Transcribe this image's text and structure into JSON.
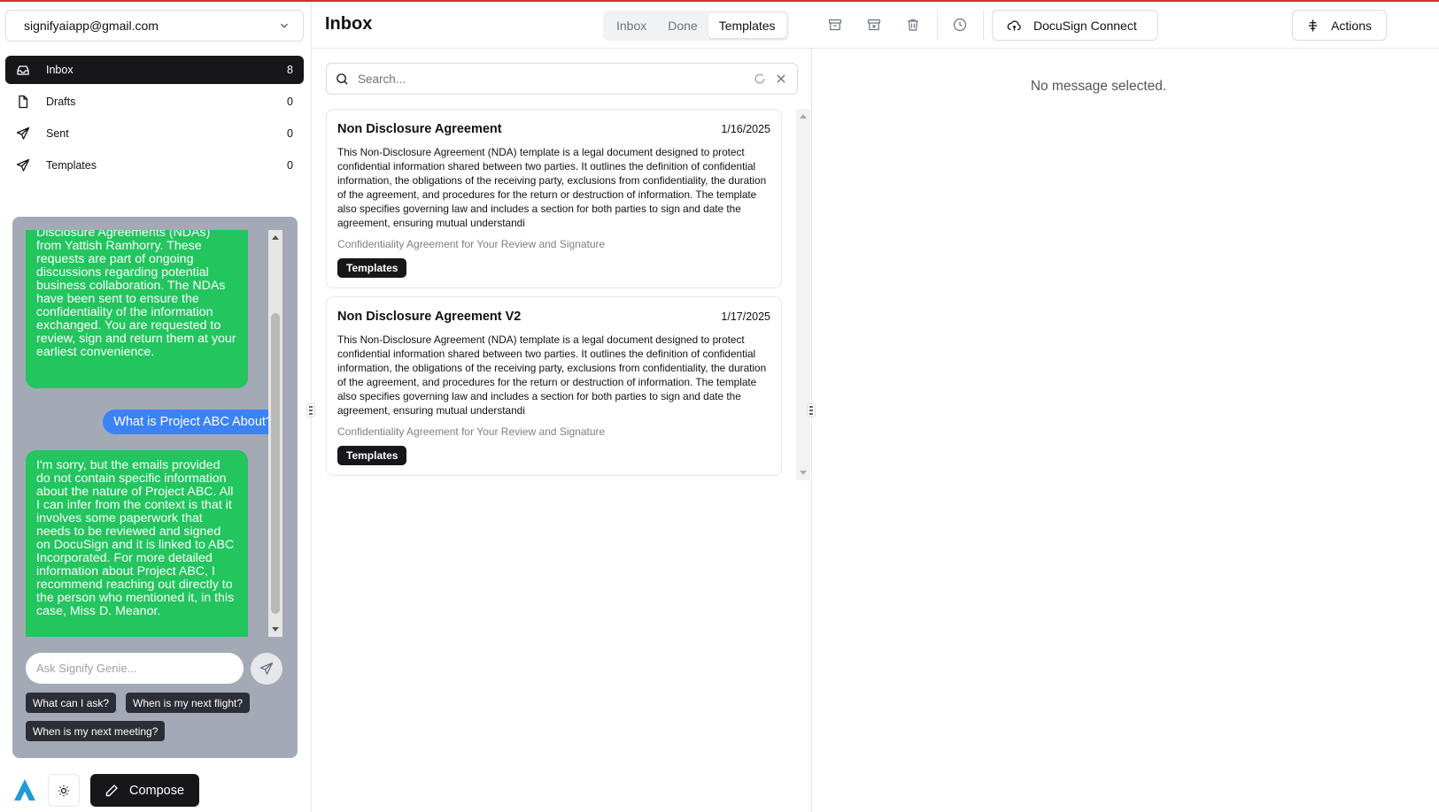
{
  "account": {
    "email": "signifyaiapp@gmail.com"
  },
  "nav": [
    {
      "label": "Inbox",
      "count": "8",
      "icon": "inbox-icon"
    },
    {
      "label": "Drafts",
      "count": "0",
      "icon": "file-icon"
    },
    {
      "label": "Sent",
      "count": "0",
      "icon": "send-icon"
    },
    {
      "label": "Templates",
      "count": "0",
      "icon": "send-icon"
    }
  ],
  "genie": {
    "messages": [
      {
        "role": "assistant",
        "text": "Disclosure Agreements (NDAs) from Yattish Ramhorry. These requests are part of ongoing discussions regarding potential business collaboration. The NDAs have been sent to ensure the confidentiality of the information exchanged. You are requested to review, sign and return them at your earliest convenience."
      },
      {
        "role": "user",
        "text": "What is Project ABC About?"
      },
      {
        "role": "assistant",
        "text": "I'm sorry, but the emails provided do not contain specific information about the nature of Project ABC. All I can infer from the context is that it involves some paperwork that needs to be reviewed and signed on DocuSign and it is linked to ABC Incorporated. For more detailed information about Project ABC, I recommend reaching out directly to the person who mentioned it, in this case, Miss D. Meanor."
      }
    ],
    "input_placeholder": "Ask Signify Genie...",
    "suggestions": [
      "What can I ask?",
      "When is my next flight?",
      "When is my next meeting?"
    ]
  },
  "footer": {
    "compose_label": "Compose"
  },
  "header": {
    "title": "Inbox",
    "tabs": [
      "Inbox",
      "Done",
      "Templates"
    ],
    "active_tab": "Templates",
    "docusign_label": "DocuSign Connect",
    "actions_label": "Actions"
  },
  "search": {
    "placeholder": "Search..."
  },
  "messages": [
    {
      "title": "Non Disclosure Agreement",
      "date": "1/16/2025",
      "body": "This Non-Disclosure Agreement (NDA) template is a legal document designed to protect confidential information shared between two parties. It outlines the definition of confidential information, the obligations of the receiving party, exclusions from confidentiality, the duration of the agreement, and procedures for the return or destruction of information. The template also specifies governing law and includes a section for both parties to sign and date the agreement, ensuring mutual understandi",
      "subject": "Confidentiality Agreement for Your Review and Signature",
      "tag": "Templates"
    },
    {
      "title": "Non Disclosure Agreement V2",
      "date": "1/17/2025",
      "body": "This Non-Disclosure Agreement (NDA) template is a legal document designed to protect confidential information shared between two parties. It outlines the definition of confidential information, the obligations of the receiving party, exclusions from confidentiality, the duration of the agreement, and procedures for the return or destruction of information. The template also specifies governing law and includes a section for both parties to sign and date the agreement, ensuring mutual understandi",
      "subject": "Confidentiality Agreement for Your Review and Signature",
      "tag": "Templates"
    }
  ],
  "detail": {
    "empty_text": "No message selected."
  },
  "colors": {
    "accent_dark": "#17171a",
    "bot_bubble": "#22c55e",
    "user_bubble": "#3b82f6",
    "genie_panel": "#a3aab6",
    "top_border": "#d32f2f"
  }
}
